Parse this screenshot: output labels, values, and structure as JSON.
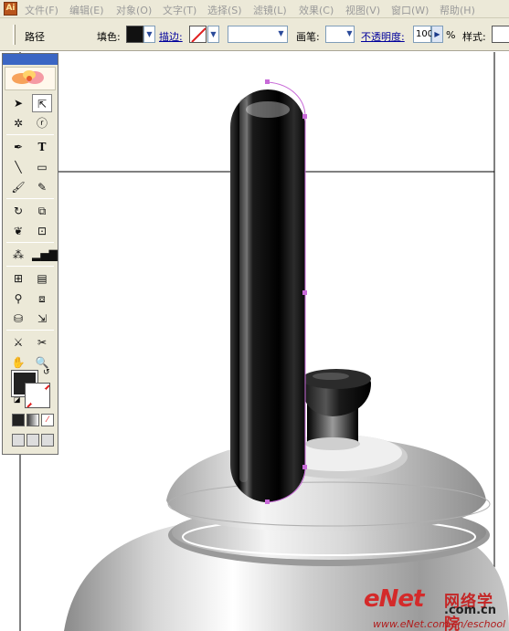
{
  "menubar": {
    "app_icon": "Ai",
    "items": [
      "文件(F)",
      "编辑(E)",
      "对象(O)",
      "文字(T)",
      "选择(S)",
      "滤镜(L)",
      "效果(C)",
      "视图(V)",
      "窗口(W)",
      "帮助(H)"
    ]
  },
  "controlbar": {
    "object_type": "路径",
    "fill_label": "填色:",
    "stroke_label": "描边:",
    "brush_label": "画笔:",
    "opacity_label": "不透明度:",
    "opacity_value": "100",
    "opacity_unit": "%",
    "style_label": "样式:",
    "fill_color": "#111111"
  },
  "toolbox": {
    "tools": [
      {
        "name": "selection-tool",
        "icon": "arrow-icon"
      },
      {
        "name": "direct-selection-tool",
        "icon": "hollow-arrow-icon"
      },
      {
        "name": "magic-wand-tool",
        "icon": "wand-icon"
      },
      {
        "name": "lasso-tool",
        "icon": "lasso-icon"
      },
      {
        "name": "pen-tool",
        "icon": "pen-icon"
      },
      {
        "name": "type-tool",
        "icon": "type-icon",
        "glyph": "T"
      },
      {
        "name": "line-tool",
        "icon": "line-icon"
      },
      {
        "name": "rectangle-tool",
        "icon": "rectangle-icon"
      },
      {
        "name": "paintbrush-tool",
        "icon": "brush-icon"
      },
      {
        "name": "pencil-tool",
        "icon": "pencil-icon"
      },
      {
        "name": "rotate-tool",
        "icon": "rotate-icon"
      },
      {
        "name": "scale-tool",
        "icon": "scale-icon"
      },
      {
        "name": "warp-tool",
        "icon": "warp-icon"
      },
      {
        "name": "free-transform-tool",
        "icon": "free-transform-icon"
      },
      {
        "name": "symbol-sprayer-tool",
        "icon": "sprayer-icon"
      },
      {
        "name": "graph-tool",
        "icon": "graph-icon"
      },
      {
        "name": "mesh-tool",
        "icon": "mesh-icon"
      },
      {
        "name": "gradient-tool",
        "icon": "gradient-icon"
      },
      {
        "name": "eyedropper-tool",
        "icon": "eyedropper-icon"
      },
      {
        "name": "blend-tool",
        "icon": "blend-icon"
      },
      {
        "name": "live-paint-tool",
        "icon": "paint-bucket-icon"
      },
      {
        "name": "live-paint-selection-tool",
        "icon": "paint-selection-icon"
      },
      {
        "name": "slice-tool",
        "icon": "slice-icon"
      },
      {
        "name": "scissors-tool",
        "icon": "scissors-icon"
      },
      {
        "name": "hand-tool",
        "icon": "hand-icon"
      },
      {
        "name": "zoom-tool",
        "icon": "magnifier-icon"
      }
    ],
    "fill_color": "#222222",
    "stroke_color": "none"
  },
  "watermark": {
    "brand": "eNet",
    "brand_cn": "网络学院",
    "domain": ".com.cn",
    "url": "www.eNet.com.cn/eschool"
  }
}
